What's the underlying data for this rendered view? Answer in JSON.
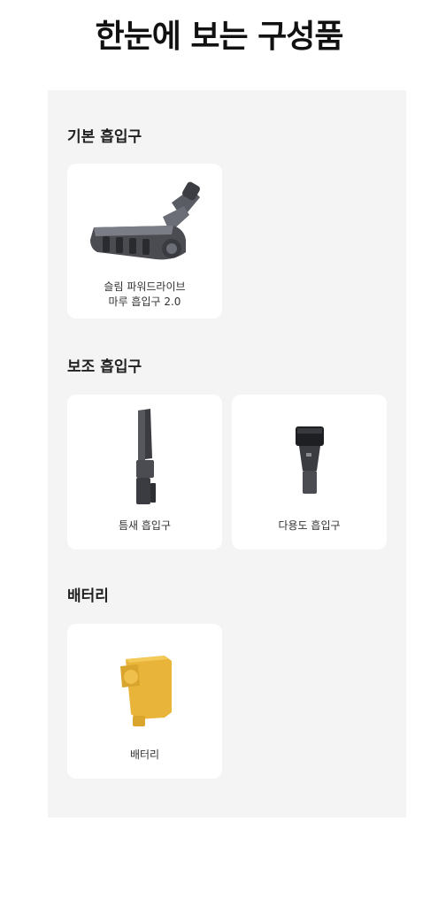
{
  "page": {
    "title": "한눈에 보는 구성품"
  },
  "sections": [
    {
      "title": "기본 흡입구",
      "items": [
        {
          "name_line1": "슬림 파워드라이브",
          "name_line2": "마루 흡입구 2.0",
          "icon": "powered-floor-head-icon"
        }
      ]
    },
    {
      "title": "보조 흡입구",
      "items": [
        {
          "name_line1": "틈새 흡입구",
          "icon": "crevice-tool-icon"
        },
        {
          "name_line1": "다용도 흡입구",
          "icon": "multi-purpose-tool-icon"
        }
      ]
    },
    {
      "title": "배터리",
      "items": [
        {
          "name_line1": "배터리",
          "icon": "battery-icon",
          "color": "#e9b43a"
        }
      ]
    }
  ],
  "colors": {
    "panel_background": "#f4f4f4",
    "card_background": "#ffffff",
    "battery": "#e9b43a"
  }
}
